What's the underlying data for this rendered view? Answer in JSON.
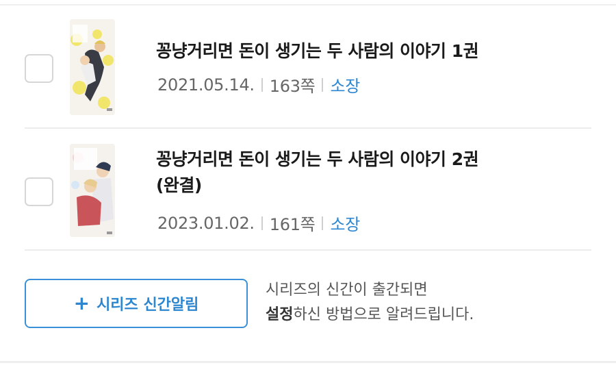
{
  "books": [
    {
      "title": "꽁냥거리면 돈이 생기는 두 사람의 이야기 1권",
      "date": "2021.05.14.",
      "pages": "163쪽",
      "ownership": "소장"
    },
    {
      "title_line1": "꽁냥거리면 돈이 생기는 두 사람의 이야기 2권",
      "title_line2": "(완결)",
      "date": "2023.01.02.",
      "pages": "161쪽",
      "ownership": "소장"
    }
  ],
  "alarm": {
    "button_label": "시리즈 신간알림",
    "desc_line1": "시리즈의 신간이 출간되면",
    "desc_bold": "설정",
    "desc_rest": "하신 방법으로 알려드립니다."
  },
  "colors": {
    "accent": "#2d86d0",
    "border": "#3b8fd6",
    "divider": "#ececec"
  }
}
